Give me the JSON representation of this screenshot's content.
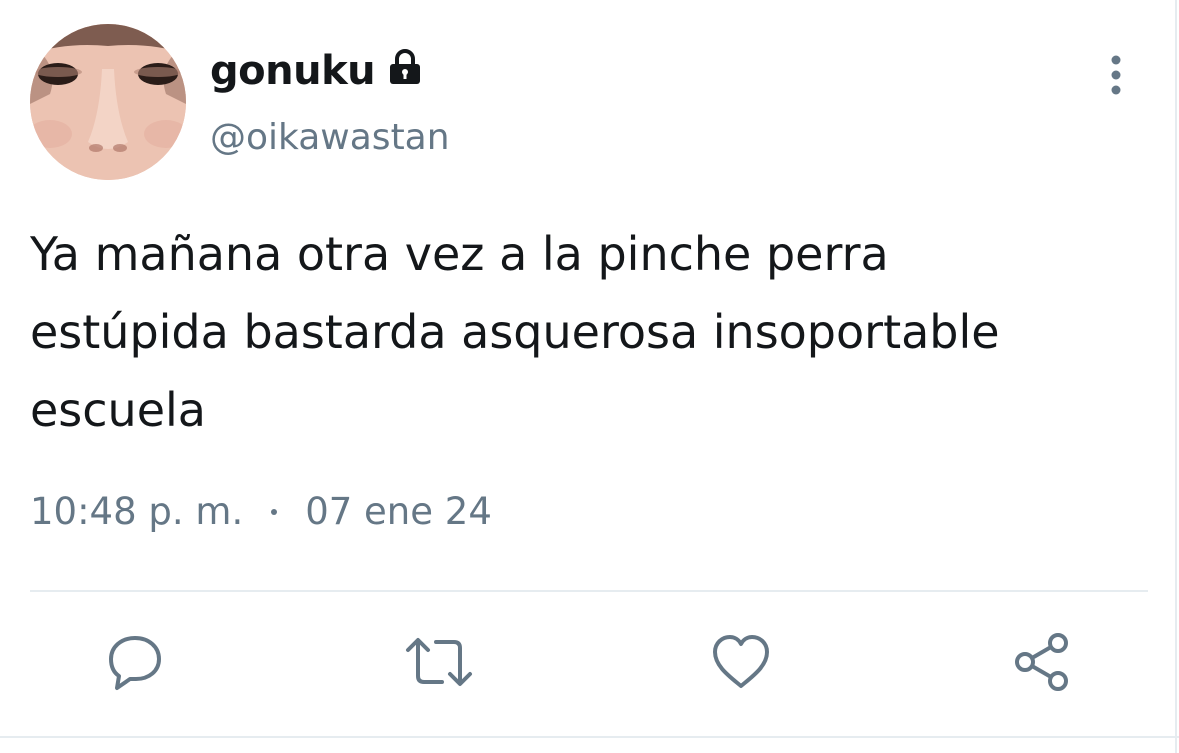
{
  "user": {
    "display_name": "gonuku",
    "handle": "@oikawastan",
    "avatar_icon": "avatar-photo",
    "protected_icon": "lock-icon"
  },
  "tweet": {
    "lines": [
      "Ya mañana otra vez a la pinche perra",
      "estúpida bastarda asquerosa insoportable",
      "escuela"
    ],
    "time": "10:48 p. m.",
    "date": "07 ene 24"
  },
  "actions": {
    "reply_icon": "reply-icon",
    "retweet_icon": "retweet-icon",
    "like_icon": "heart-icon",
    "share_icon": "share-icon",
    "more_icon": "more-vertical-icon"
  },
  "colors": {
    "text": "#14171a",
    "secondary": "#657786",
    "divider": "#e6ecf0"
  }
}
